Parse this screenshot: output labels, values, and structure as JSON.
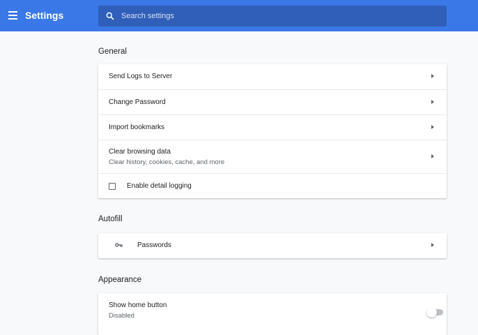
{
  "header": {
    "title": "Settings",
    "menu_icon": "hamburger-menu-icon",
    "search": {
      "placeholder": "Search settings",
      "value": "",
      "icon": "search-icon"
    },
    "background_color": "#3b78e7"
  },
  "sections": {
    "general": {
      "title": "General",
      "items": [
        {
          "label": "Send Logs to Server"
        },
        {
          "label": "Change Password"
        },
        {
          "label": "Import bookmarks"
        },
        {
          "label": "Clear browsing data",
          "sublabel": "Clear history, cookies, cache, and more"
        },
        {
          "label": "Enable detail logging",
          "checked": false
        }
      ]
    },
    "autofill": {
      "title": "Autofill",
      "items": [
        {
          "label": "Passwords",
          "icon": "key-icon"
        }
      ]
    },
    "appearance": {
      "title": "Appearance",
      "items": [
        {
          "label": "Show home button",
          "sublabel": "Disabled",
          "enabled": false
        }
      ]
    }
  }
}
